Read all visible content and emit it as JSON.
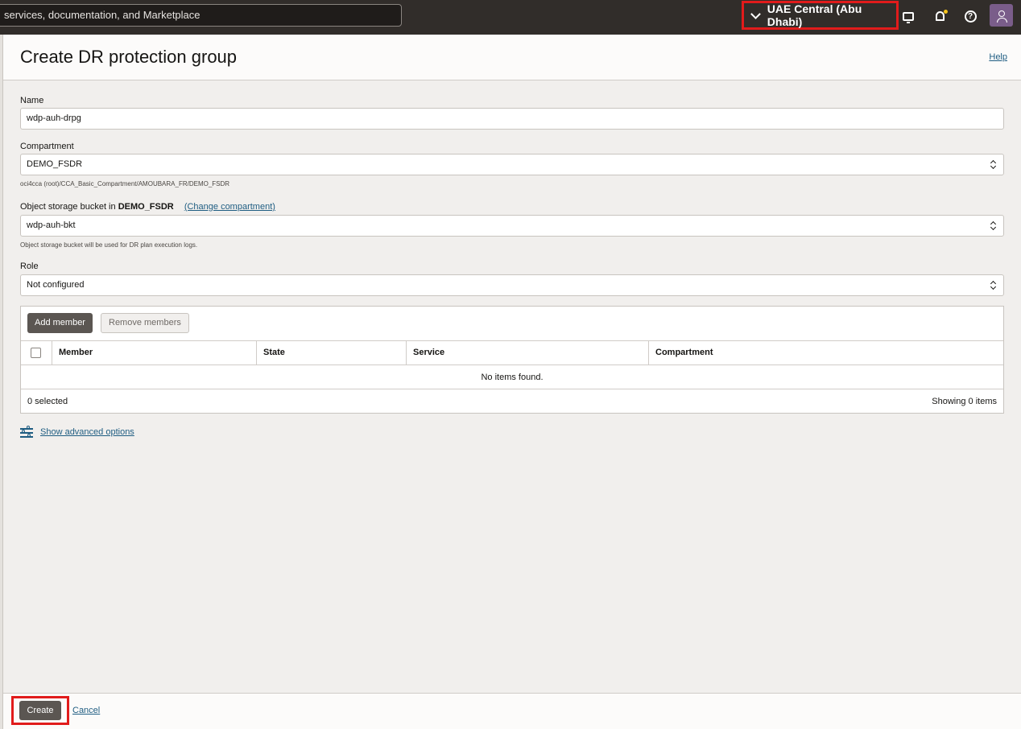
{
  "topbar": {
    "search_placeholder": "services, documentation, and Marketplace",
    "region": "UAE Central (Abu Dhabi)"
  },
  "panel": {
    "title": "Create DR protection group",
    "help": "Help"
  },
  "form": {
    "name_label": "Name",
    "name_value": "wdp-auh-drpg",
    "compartment_label": "Compartment",
    "compartment_value": "DEMO_FSDR",
    "compartment_path": "oci4cca (root)/CCA_Basic_Compartment/AMOUBARA_FR/DEMO_FSDR",
    "bucket_label_prefix": "Object storage bucket in",
    "bucket_label_compartment": "DEMO_FSDR",
    "change_compartment": "(Change compartment)",
    "bucket_value": "wdp-auh-bkt",
    "bucket_help": "Object storage bucket will be used for DR plan execution logs.",
    "role_label": "Role",
    "role_value": "Not configured"
  },
  "members": {
    "add_button": "Add member",
    "remove_button": "Remove members",
    "columns": [
      "Member",
      "State",
      "Service",
      "Compartment"
    ],
    "empty": "No items found.",
    "selected": "0 selected",
    "showing": "Showing 0 items"
  },
  "advanced": "Show advanced options",
  "footer": {
    "create": "Create",
    "cancel": "Cancel"
  },
  "colors": {
    "topbar": "#312d2a",
    "highlight": "#e11b1b",
    "link": "#1f5d82",
    "primary_button": "#5b5652"
  }
}
